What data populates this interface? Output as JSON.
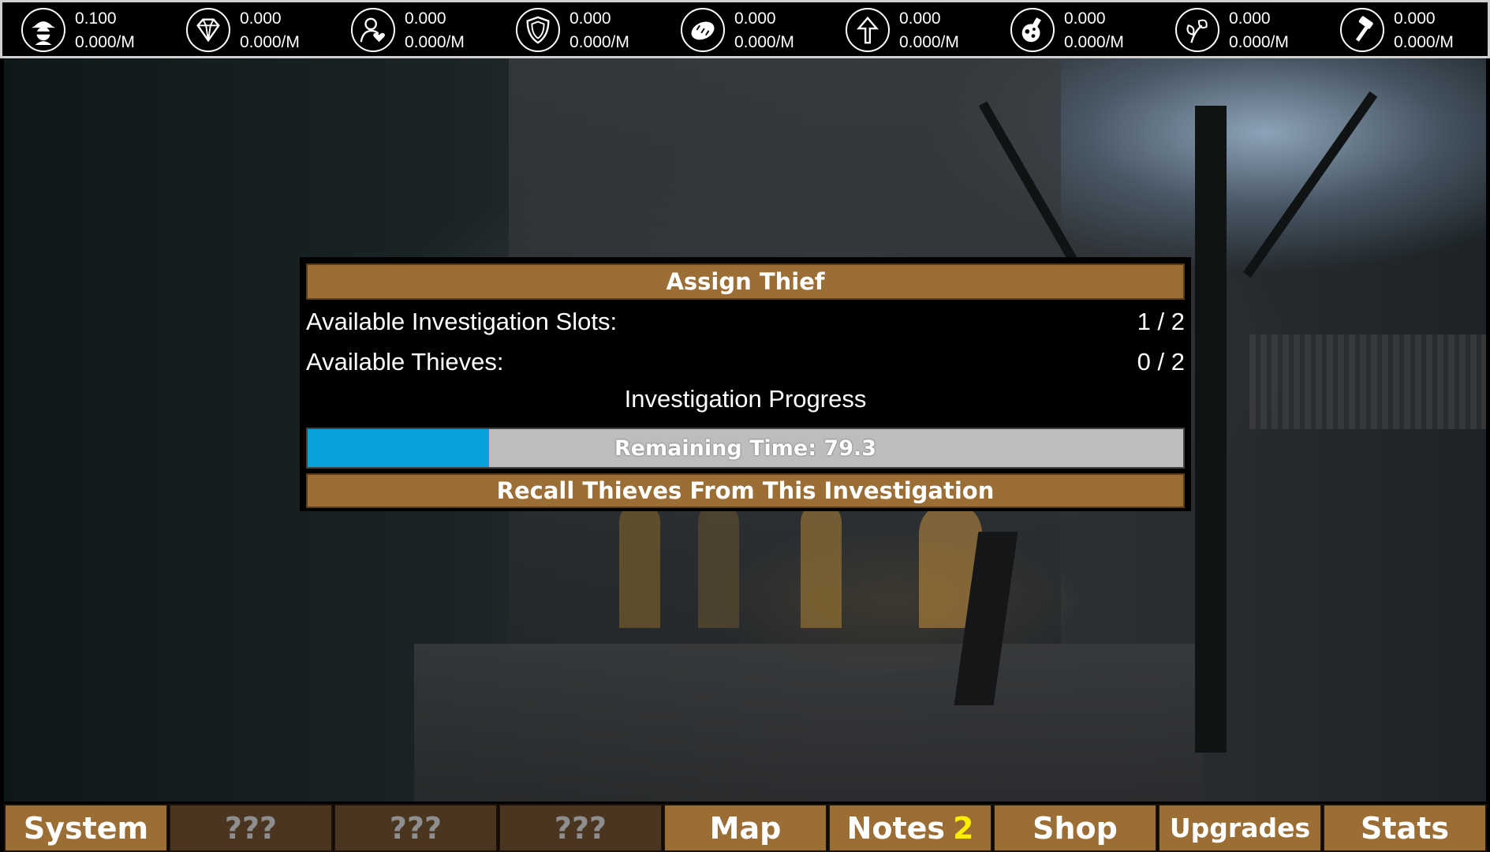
{
  "resources": [
    {
      "icon": "thief-icon",
      "amount": "0.100",
      "rate": "0.000/M"
    },
    {
      "icon": "diamond-icon",
      "amount": "0.000",
      "rate": "0.000/M"
    },
    {
      "icon": "contact-icon",
      "amount": "0.000",
      "rate": "0.000/M"
    },
    {
      "icon": "shield-icon",
      "amount": "0.000",
      "rate": "0.000/M"
    },
    {
      "icon": "bread-icon",
      "amount": "0.000",
      "rate": "0.000/M"
    },
    {
      "icon": "arrow-up-icon",
      "amount": "0.000",
      "rate": "0.000/M"
    },
    {
      "icon": "potion-icon",
      "amount": "0.000",
      "rate": "0.000/M"
    },
    {
      "icon": "herb-icon",
      "amount": "0.000",
      "rate": "0.000/M"
    },
    {
      "icon": "hammer-icon",
      "amount": "0.000",
      "rate": "0.000/M"
    }
  ],
  "dialog": {
    "title": "Assign Thief",
    "slots_label": "Available Investigation Slots:",
    "slots_value": "1 / 2",
    "thieves_label": "Available Thieves:",
    "thieves_value": "0 / 2",
    "progress_label": "Investigation Progress",
    "progress_fraction": 0.207,
    "remaining_text": "Remaining Time: 79.3",
    "recall_label": "Recall Thieves From This Investigation"
  },
  "nav": {
    "system": "System",
    "locked1": "???",
    "locked2": "???",
    "locked3": "???",
    "map": "Map",
    "notes": "Notes",
    "notes_badge": "2",
    "shop": "Shop",
    "upgrades": "Upgrades",
    "stats": "Stats"
  },
  "colors": {
    "panel_brown": "#9a6e35",
    "locked_brown": "#4a3521",
    "progress_blue": "#0aa1dd",
    "badge_yellow": "#ffee00"
  }
}
